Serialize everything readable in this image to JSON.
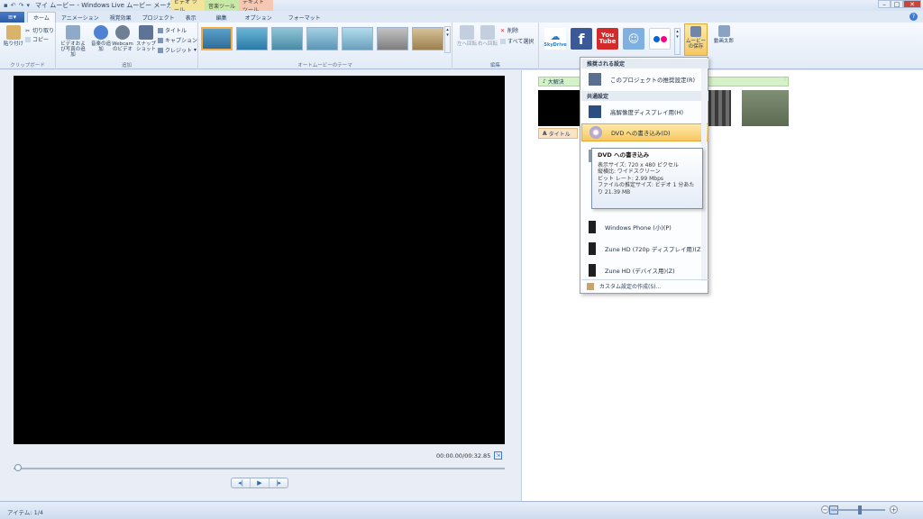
{
  "window": {
    "title": "マイ ムービー - Windows Live ムービー メーカー",
    "context_tabs": [
      "ビデオ ツール",
      "音楽ツール",
      "テキスト ツール"
    ]
  },
  "tabs": [
    "ホーム",
    "アニメーション",
    "視覚効果",
    "プロジェクト",
    "表示",
    "編集",
    "オプション",
    "フォーマット"
  ],
  "ribbon": {
    "clipboard": {
      "label": "クリップボード",
      "paste": "貼り付け",
      "cut": "切り取り",
      "copy": "コピー"
    },
    "add": {
      "label": "追加",
      "add_video": "ビデオおよび写真の追加",
      "add_music": "音楽の追加",
      "webcam": "Webcam のビデオ",
      "snapshot": "スナップショット",
      "title": "タイトル",
      "caption": "キャプション",
      "credits": "クレジット"
    },
    "automovie_label": "オートムービーのテーマ",
    "edit": {
      "label": "編集",
      "rotate_left": "左へ回転",
      "rotate_right": "右へ回転",
      "delete": "削除",
      "select_all": "すべて選択"
    },
    "share": {
      "skydrive": "SkyDrive",
      "facebook": "f",
      "youtube": "You Tube",
      "save_movie": "ムービーの保存",
      "sign_in": "動画太郎"
    }
  },
  "preview": {
    "time": "00:00.00/00:32.85"
  },
  "storyboard": {
    "music_track": "大解決",
    "title_track": "タイトル"
  },
  "save_menu": {
    "section_recommended": "推奨される設定",
    "recommended_item": "このプロジェクトの推奨設定(R)",
    "section_common": "共通設定",
    "hd_display": "高解像度ディスプレイ用(H)",
    "dvd": "DVD への書き込み(D)",
    "windows_phone_small": "Windows Phone (小)(P)",
    "zune_hd_720": "Zune HD (720p ディスプレイ用)(Z)",
    "zune_hd_device": "Zune HD (デバイス用)(Z)",
    "custom": "カスタム設定の作成(S)..."
  },
  "tooltip": {
    "title": "DVD への書き込み",
    "line1": "表示サイズ: 720 x 480 ピクセル",
    "line2": "縦横比: ワイドスクリーン",
    "line3": "ビット レート: 2.99 Mbps",
    "line4": "ファイルの推定サイズ: ビデオ 1 分あたり 21.39 MB"
  },
  "status": {
    "items": "アイテム: 1/4"
  },
  "colors": {
    "accent": "#f3b04a",
    "ribbon_blue": "#2d5ca6"
  }
}
